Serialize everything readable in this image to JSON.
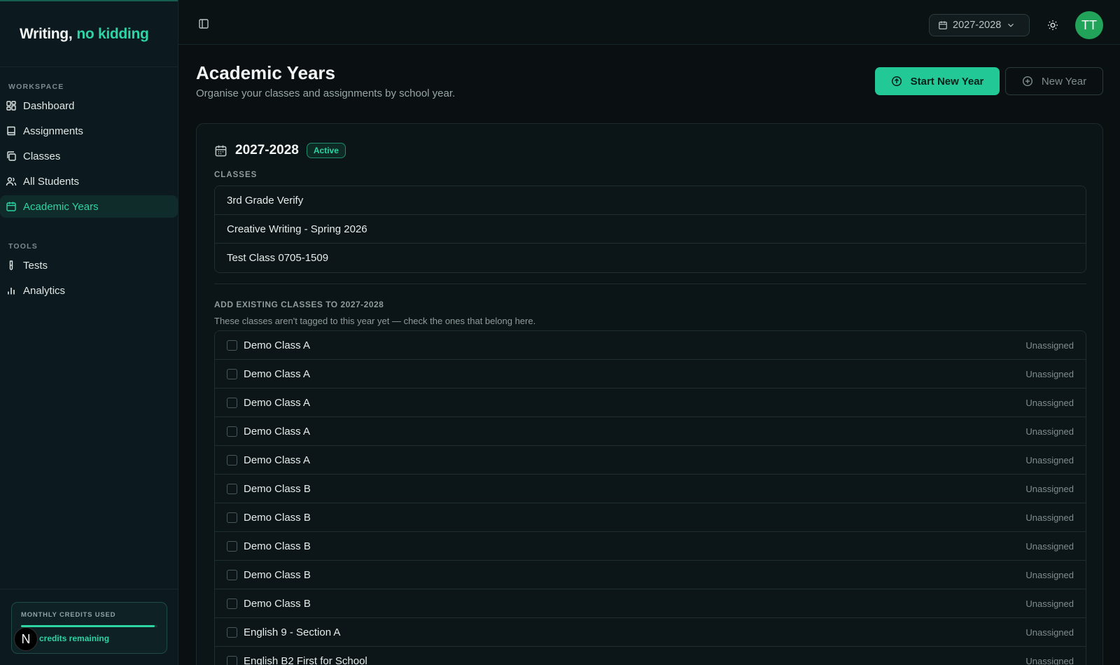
{
  "brand": {
    "part1": "Writing,",
    "part2": "no kidding"
  },
  "sidebar": {
    "workspace_label": "WORKSPACE",
    "workspace_items": [
      {
        "label": "Dashboard",
        "icon": "grid-icon"
      },
      {
        "label": "Assignments",
        "icon": "book-icon"
      },
      {
        "label": "Classes",
        "icon": "copy-icon"
      },
      {
        "label": "All Students",
        "icon": "users-icon"
      },
      {
        "label": "Academic Years",
        "icon": "calendar-icon",
        "active": true
      }
    ],
    "tools_label": "TOOLS",
    "tools_items": [
      {
        "label": "Tests",
        "icon": "test-tube-icon"
      },
      {
        "label": "Analytics",
        "icon": "bar-chart-icon"
      }
    ],
    "credits": {
      "label": "MONTHLY CREDITS USED",
      "remaining_text": "credits remaining",
      "used_fraction": 0.98
    },
    "n_badge": "N"
  },
  "topbar": {
    "year_select": "2027-2028",
    "avatar": "TT"
  },
  "page": {
    "title": "Academic Years",
    "subtitle": "Organise your classes and assignments by school year.",
    "start_button": "Start New Year",
    "new_button": "New Year"
  },
  "year_card": {
    "year": "2027-2028",
    "status": "Active",
    "classes_label": "CLASSES",
    "classes": [
      "3rd Grade Verify",
      "Creative Writing - Spring 2026",
      "Test Class 0705-1509"
    ],
    "add_label": "ADD EXISTING CLASSES TO 2027-2028",
    "add_subtitle": "These classes aren't tagged to this year yet — check the ones that belong here.",
    "existing": [
      {
        "name": "Demo Class A",
        "status": "Unassigned"
      },
      {
        "name": "Demo Class A",
        "status": "Unassigned"
      },
      {
        "name": "Demo Class A",
        "status": "Unassigned"
      },
      {
        "name": "Demo Class A",
        "status": "Unassigned"
      },
      {
        "name": "Demo Class A",
        "status": "Unassigned"
      },
      {
        "name": "Demo Class B",
        "status": "Unassigned"
      },
      {
        "name": "Demo Class B",
        "status": "Unassigned"
      },
      {
        "name": "Demo Class B",
        "status": "Unassigned"
      },
      {
        "name": "Demo Class B",
        "status": "Unassigned"
      },
      {
        "name": "Demo Class B",
        "status": "Unassigned"
      },
      {
        "name": "English 9 - Section A",
        "status": "Unassigned"
      },
      {
        "name": "English B2 First for School",
        "status": "Unassigned"
      }
    ]
  },
  "colors": {
    "accent": "#2dd4a4",
    "button": "#22c997",
    "avatar": "#22a35a",
    "background": "#0a1012"
  }
}
